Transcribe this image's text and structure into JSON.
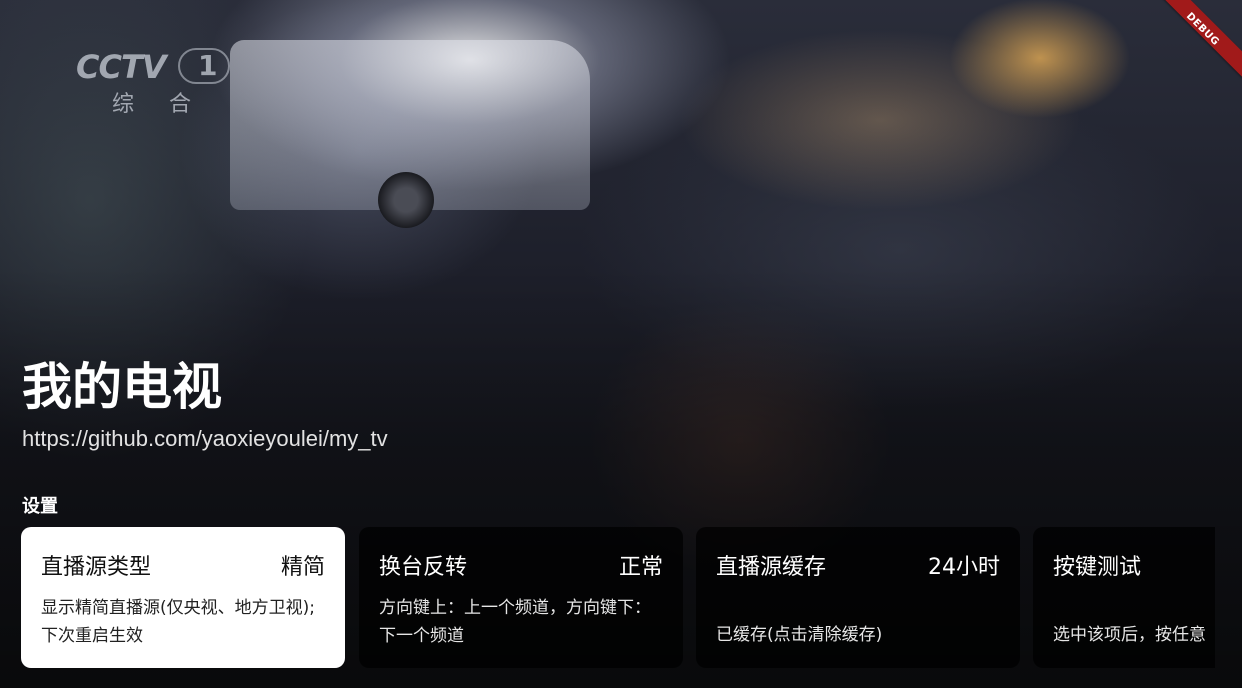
{
  "channel_logo": {
    "brand": "CCTV",
    "number": "1",
    "subtitle": "综 合"
  },
  "debug_banner": "DEBUG",
  "app": {
    "title": "我的电视",
    "url": "https://github.com/yaoxieyoulei/my_tv"
  },
  "settings": {
    "section_title": "设置",
    "items": [
      {
        "title": "直播源类型",
        "value": "精简",
        "description": "显示精简直播源(仅央视、地方卫视); 下次重启生效",
        "selected": true
      },
      {
        "title": "换台反转",
        "value": "正常",
        "description": "方向键上：上一个频道，方向键下：下一个频道",
        "selected": false
      },
      {
        "title": "直播源缓存",
        "value": "24小时",
        "description": "已缓存(点击清除缓存)",
        "selected": false
      },
      {
        "title": "按键测试",
        "value": "",
        "description": "选中该项后，按任意",
        "selected": false
      }
    ]
  },
  "colors": {
    "selected_card_bg": "#ffffff",
    "card_bg": "rgba(0,0,0,0.72)",
    "debug_banner_bg": "#a11a1a"
  }
}
